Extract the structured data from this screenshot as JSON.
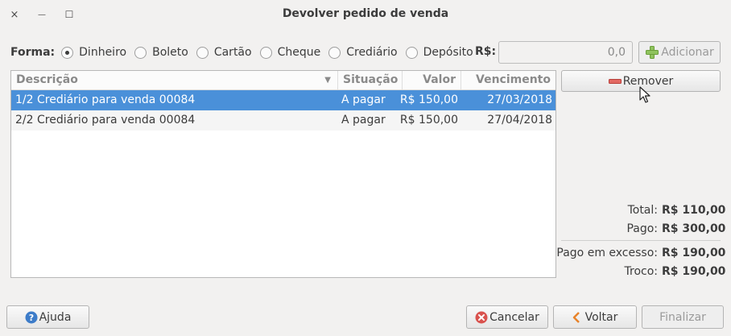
{
  "window": {
    "title": "Devolver pedido de venda",
    "close_glyph": "×",
    "minimize_glyph": "—",
    "maximize_glyph": "☐"
  },
  "payment": {
    "label": "Forma:",
    "options": [
      {
        "label": "Dinheiro",
        "checked": true
      },
      {
        "label": "Boleto",
        "checked": false
      },
      {
        "label": "Cartão",
        "checked": false
      },
      {
        "label": "Cheque",
        "checked": false
      },
      {
        "label": "Crediário",
        "checked": false
      },
      {
        "label": "Depósito",
        "checked": false
      }
    ],
    "currency_label": "R$:",
    "amount_value": "0,0",
    "add_label": "Adicionar"
  },
  "table": {
    "columns": [
      "Descrição",
      "Situação",
      "Valor",
      "Vencimento"
    ],
    "rows": [
      {
        "descricao": "1/2 Crediário para venda 00084",
        "situacao": "A pagar",
        "valor": "R$ 150,00",
        "vencimento": "27/03/2018"
      },
      {
        "descricao": "2/2 Crediário para venda 00084",
        "situacao": "A pagar",
        "valor": "R$ 150,00",
        "vencimento": "27/04/2018"
      }
    ]
  },
  "actions": {
    "remove_label": "Remover"
  },
  "totals": {
    "total_label": "Total:",
    "total_value": "R$ 110,00",
    "pago_label": "Pago:",
    "pago_value": "R$ 300,00",
    "excesso_label": "Pago em excesso:",
    "excesso_value": "R$ 190,00",
    "troco_label": "Troco:",
    "troco_value": "R$ 190,00"
  },
  "footer": {
    "help_label": "Ajuda",
    "cancel_label": "Cancelar",
    "back_label": "Voltar",
    "finish_label": "Finalizar"
  },
  "colors": {
    "selection": "#4a90d9",
    "add_icon": "#7ab648",
    "remove_icon": "#d9534f",
    "help_icon": "#3d7cc9",
    "cancel_icon": "#d9534f",
    "back_icon": "#e8832a"
  }
}
